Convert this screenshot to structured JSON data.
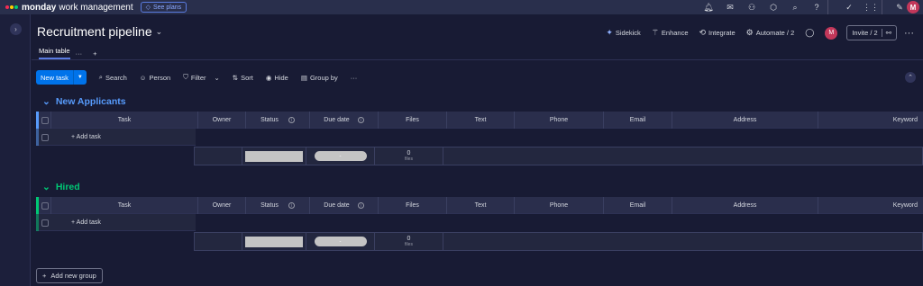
{
  "app": {
    "brand": "monday",
    "product": "work management",
    "see_plans": "See plans",
    "logo_colors": [
      "#f62b54",
      "#ffcc00",
      "#00ca72"
    ]
  },
  "topbar": {
    "icons": [
      "bell-icon",
      "inbox-icon",
      "invite-members-icon",
      "apps-icon",
      "search-icon",
      "help-icon",
      "workspace-icon",
      "grid-icon"
    ],
    "avatar_initial": "M"
  },
  "board": {
    "title": "Recruitment pipeline",
    "actions": {
      "sidekick": "Sidekick",
      "enhance": "Enhance",
      "integrate": "Integrate",
      "automate": "Automate / 2",
      "avatar_initial": "M",
      "invite": "Invite / 2"
    },
    "tabs": {
      "main": "Main table",
      "more": "···",
      "add": "+"
    }
  },
  "toolbar": {
    "new_task": "New task",
    "search": "Search",
    "person": "Person",
    "filter": "Filter",
    "sort": "Sort",
    "hide": "Hide",
    "group_by": "Group by",
    "more": "···"
  },
  "columns": [
    "Task",
    "Owner",
    "Status",
    "Due date",
    "Files",
    "Text",
    "Phone",
    "Email",
    "Address",
    "Keyword"
  ],
  "groups": [
    {
      "name": "New Applicants",
      "color": "#579bfc",
      "add_task": "+ Add task",
      "files_count": "0",
      "files_label": "files",
      "date_placeholder": "-"
    },
    {
      "name": "Hired",
      "color": "#00c875",
      "add_task": "+ Add task",
      "files_count": "0",
      "files_label": "files",
      "date_placeholder": "-"
    }
  ],
  "add_group": "Add new group"
}
